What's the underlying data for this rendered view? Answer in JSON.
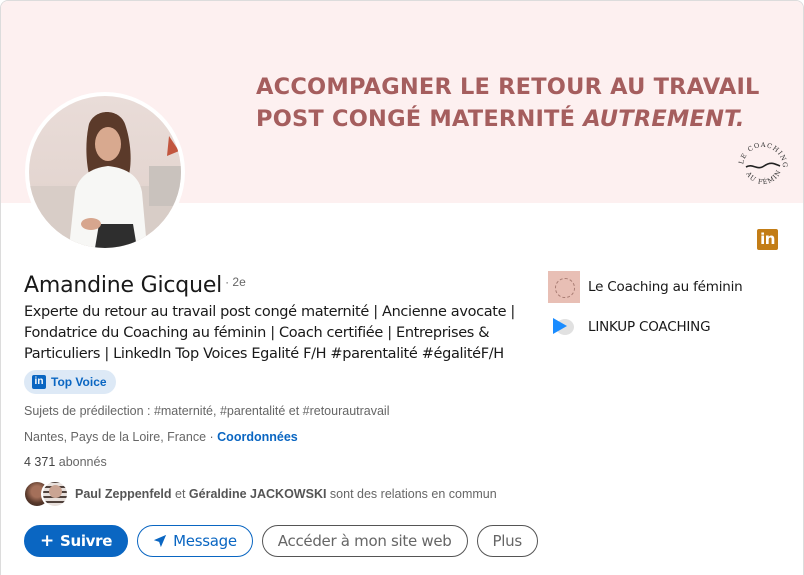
{
  "banner": {
    "headline_line1": "ACCOMPAGNER LE RETOUR AU TRAVAIL",
    "headline_line2_prefix": "POST CONGÉ MATERNITÉ ",
    "headline_line2_italic": "AUTREMENT.",
    "logo_text_top": "LE COACHING",
    "logo_text_bottom": "AU FÉMININ",
    "background_color": "#fdf0f0",
    "text_color": "#a55e5e"
  },
  "profile": {
    "name": "Amandine Gicquel",
    "degree": "· 2e",
    "headline": "Experte du retour au travail post congé maternité | Ancienne avocate | Fondatrice du Coaching au féminin | Coach certifiée | Entreprises & Particuliers | LinkedIn Top Voices Egalité F/H #parentalité #égalitéF/H",
    "badge": {
      "icon": "in",
      "label": "Top Voice"
    },
    "topics": "Sujets de prédilection : #maternité, #parentalité et #retourautravail",
    "location": "Nantes, Pays de la Loire, France",
    "location_separator": " · ",
    "contact_link": "Coordonnées",
    "followers_count": "4 371",
    "followers_label": " abonnés",
    "mutual": {
      "name1": "Paul Zeppenfeld",
      "conjunction": " et ",
      "name2": "Géraldine JACKOWSKI",
      "suffix": " sont des relations en commun"
    }
  },
  "linkedin_badge": {
    "icon": "in",
    "color": "#c37d16"
  },
  "companies": [
    {
      "name": "Le Coaching au féminin",
      "logo": "coaching-logo"
    },
    {
      "name": "LINKUP COACHING",
      "logo": "linkup-logo"
    }
  ],
  "actions": {
    "follow": {
      "icon": "+",
      "label": "Suivre"
    },
    "message": {
      "icon": "➤",
      "label": "Message"
    },
    "website": {
      "label": "Accéder à mon site web"
    },
    "more": {
      "label": "Plus"
    }
  },
  "colors": {
    "primary": "#0a66c2"
  }
}
